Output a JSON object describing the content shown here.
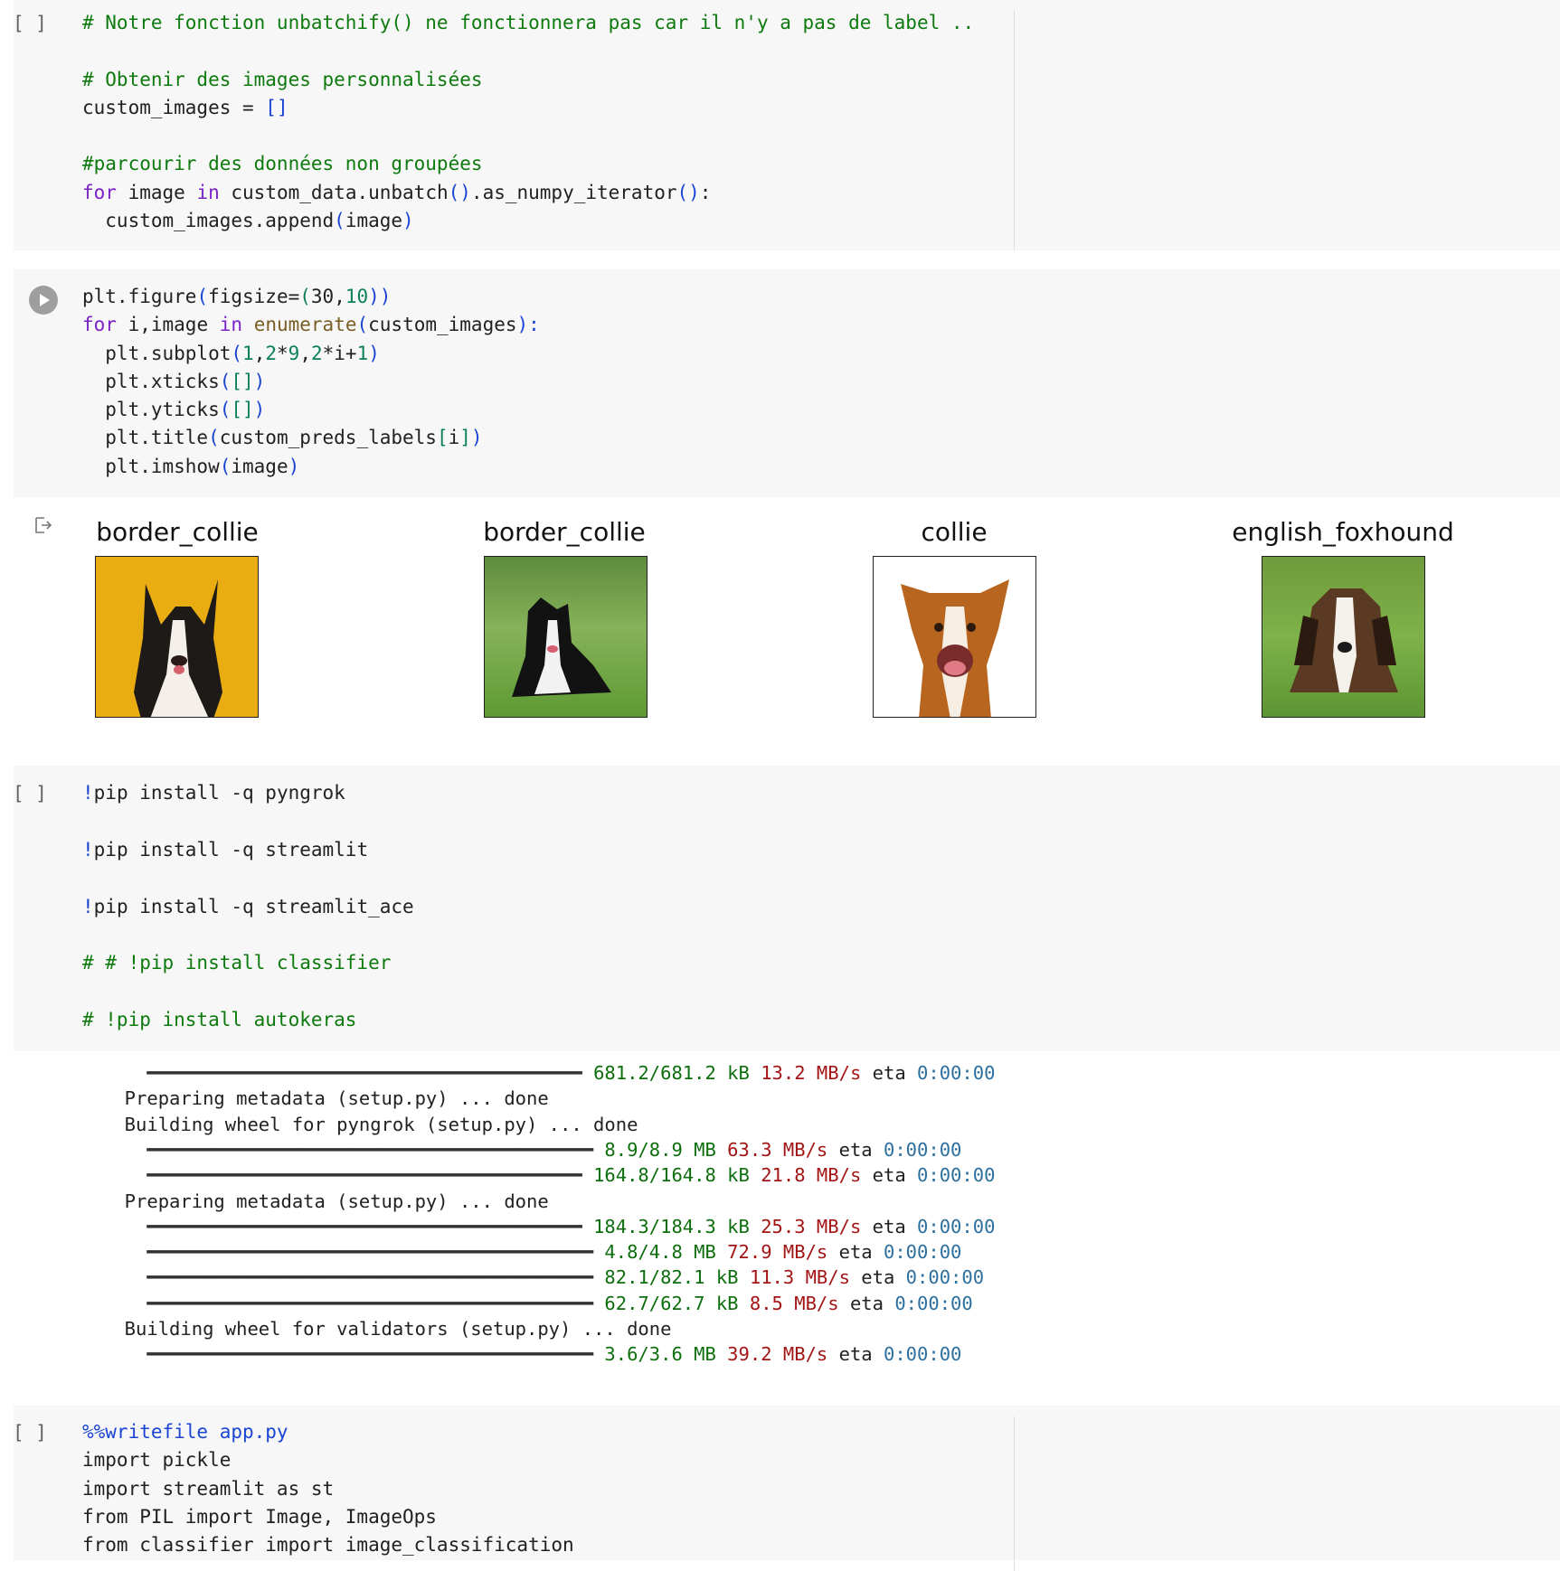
{
  "cells": [
    {
      "gutter": "[ ]",
      "lines": [
        [
          [
            "# Notre fonction unbatchify() ne fonctionnera pas car il n'y a pas de label ..",
            "c"
          ]
        ],
        [],
        [
          [
            "# Obtenir des images personnalisées",
            "c"
          ]
        ],
        [
          [
            "custom_images = ",
            ""
          ],
          [
            "[]",
            "b"
          ]
        ],
        [],
        [
          [
            "#parcourir des données non groupées",
            "c"
          ]
        ],
        [
          [
            "for",
            "k"
          ],
          [
            " image ",
            ""
          ],
          [
            "in",
            "k"
          ],
          [
            " custom_data.unbatch",
            ""
          ],
          [
            "()",
            "b"
          ],
          [
            ".as_numpy_iterator",
            ""
          ],
          [
            "()",
            "b"
          ],
          [
            ":",
            ""
          ]
        ],
        [
          [
            "  custom_images.append",
            ""
          ],
          [
            "(",
            "b"
          ],
          [
            "image",
            ""
          ],
          [
            ")",
            "b"
          ]
        ]
      ]
    },
    {
      "lines": [
        [
          [
            "plt.figure",
            ""
          ],
          [
            "(",
            "b"
          ],
          [
            "figsize=",
            ""
          ],
          [
            "(",
            "n"
          ],
          [
            "30",
            ""
          ],
          [
            ",",
            ""
          ],
          [
            "10",
            "n"
          ],
          [
            "))",
            "b"
          ]
        ],
        [
          [
            "for",
            "k"
          ],
          [
            " i,image ",
            ""
          ],
          [
            "in",
            "k"
          ],
          [
            " ",
            ""
          ],
          [
            "enumerate",
            "f"
          ],
          [
            "(",
            "b"
          ],
          [
            "custom_images",
            ""
          ],
          [
            "):",
            "b"
          ]
        ],
        [
          [
            "  plt.subplot",
            ""
          ],
          [
            "(",
            "b"
          ],
          [
            "1",
            "n"
          ],
          [
            ",",
            ""
          ],
          [
            "2",
            "n"
          ],
          [
            "*",
            ""
          ],
          [
            "9",
            "n"
          ],
          [
            ",",
            ""
          ],
          [
            "2",
            "n"
          ],
          [
            "*i+",
            ""
          ],
          [
            "1",
            "n"
          ],
          [
            ")",
            "b"
          ]
        ],
        [
          [
            "  plt.xticks",
            ""
          ],
          [
            "(",
            "b"
          ],
          [
            "[]",
            "n"
          ],
          [
            ")",
            "b"
          ]
        ],
        [
          [
            "  plt.yticks",
            ""
          ],
          [
            "(",
            "b"
          ],
          [
            "[]",
            "n"
          ],
          [
            ")",
            "b"
          ]
        ],
        [
          [
            "  plt.title",
            ""
          ],
          [
            "(",
            "b"
          ],
          [
            "custom_preds_labels",
            ""
          ],
          [
            "[",
            "n"
          ],
          [
            "i",
            ""
          ],
          [
            "]",
            "n"
          ],
          [
            ")",
            "b"
          ]
        ],
        [
          [
            "  plt.imshow",
            ""
          ],
          [
            "(",
            "b"
          ],
          [
            "image",
            ""
          ],
          [
            ")",
            "b"
          ]
        ]
      ],
      "plots": [
        "border_collie",
        "border_collie",
        "collie",
        "english_foxhound"
      ]
    },
    {
      "gutter": "[ ]",
      "lines": [
        [
          [
            "!",
            "m"
          ],
          [
            "pip install -q pyngrok",
            ""
          ]
        ],
        [],
        [
          [
            "!",
            "m"
          ],
          [
            "pip install -q streamlit",
            ""
          ]
        ],
        [],
        [
          [
            "!",
            "m"
          ],
          [
            "pip install -q streamlit_ace",
            ""
          ]
        ],
        [],
        [
          [
            "# # !pip install classifier",
            "c"
          ]
        ],
        [],
        [
          [
            "# !pip install autokeras",
            "c"
          ]
        ]
      ]
    },
    {
      "gutter": "[ ]",
      "lines": [
        [
          [
            "%%writefile app.py",
            "b"
          ]
        ],
        [
          [
            "import pickle",
            ""
          ]
        ],
        [
          [
            "import streamlit as st",
            ""
          ]
        ],
        [
          [
            "from PIL import Image, ImageOps",
            ""
          ]
        ],
        [
          [
            "from classifier import image_classification",
            ""
          ]
        ]
      ]
    }
  ],
  "pip_output": [
    {
      "type": "bar",
      "bar": "━━━━━━━━━━━━━━━━━━━━━━━━━━━━━━━━━━━━━━━",
      "size": "681.2/681.2 kB",
      "speed": "13.2 MB/s",
      "eta_label": "eta",
      "eta": "0:00:00"
    },
    {
      "type": "text",
      "text": "  Preparing metadata (setup.py) ... done"
    },
    {
      "type": "text",
      "text": "  Building wheel for pyngrok (setup.py) ... done"
    },
    {
      "type": "bar",
      "bar": "━━━━━━━━━━━━━━━━━━━━━━━━━━━━━━━━━━━━━━━━",
      "size": "8.9/8.9 MB",
      "speed": "63.3 MB/s",
      "eta_label": "eta",
      "eta": "0:00:00"
    },
    {
      "type": "bar",
      "bar": "━━━━━━━━━━━━━━━━━━━━━━━━━━━━━━━━━━━━━━━",
      "size": "164.8/164.8 kB",
      "speed": "21.8 MB/s",
      "eta_label": "eta",
      "eta": "0:00:00"
    },
    {
      "type": "text",
      "text": "  Preparing metadata (setup.py) ... done"
    },
    {
      "type": "bar",
      "bar": "━━━━━━━━━━━━━━━━━━━━━━━━━━━━━━━━━━━━━━━",
      "size": "184.3/184.3 kB",
      "speed": "25.3 MB/s",
      "eta_label": "eta",
      "eta": "0:00:00"
    },
    {
      "type": "bar",
      "bar": "━━━━━━━━━━━━━━━━━━━━━━━━━━━━━━━━━━━━━━━━",
      "size": "4.8/4.8 MB",
      "speed": "72.9 MB/s",
      "eta_label": "eta",
      "eta": "0:00:00"
    },
    {
      "type": "bar",
      "bar": "━━━━━━━━━━━━━━━━━━━━━━━━━━━━━━━━━━━━━━━━",
      "size": "82.1/82.1 kB",
      "speed": "11.3 MB/s",
      "eta_label": "eta",
      "eta": "0:00:00"
    },
    {
      "type": "bar",
      "bar": "━━━━━━━━━━━━━━━━━━━━━━━━━━━━━━━━━━━━━━━━",
      "size": "62.7/62.7 kB",
      "speed": "8.5 MB/s",
      "eta_label": "eta",
      "eta": "0:00:00"
    },
    {
      "type": "text",
      "text": "  Building wheel for validators (setup.py) ... done"
    },
    {
      "type": "bar",
      "bar": "━━━━━━━━━━━━━━━━━━━━━━━━━━━━━━━━━━━━━━━━",
      "size": "3.6/3.6 MB",
      "speed": "39.2 MB/s",
      "eta_label": "eta",
      "eta": "0:00:00"
    }
  ],
  "icons": {
    "run": "play-circle-icon",
    "output": "output-redirect-icon"
  },
  "colors": {
    "cell_bg": "#f7f7f7",
    "comment": "#0d7a0d",
    "keyword": "#7b22c8",
    "bracket": "#1a45d4",
    "number": "#0b7f5c"
  }
}
